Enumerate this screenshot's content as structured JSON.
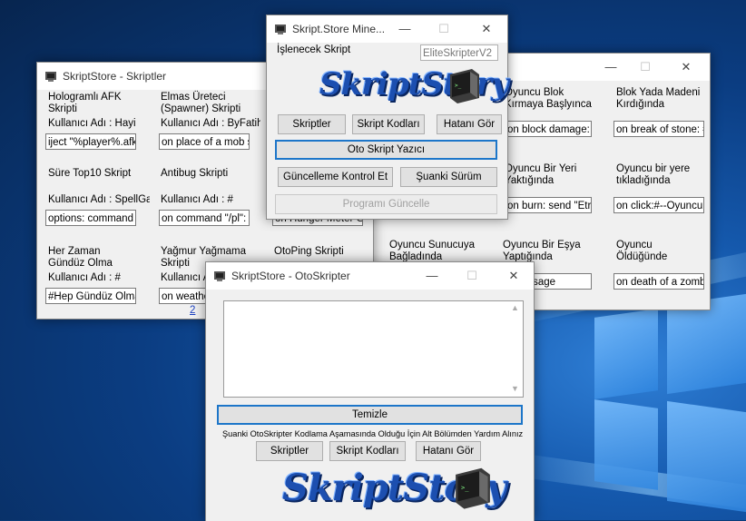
{
  "desktop": {
    "bg": "#0b3c78"
  },
  "win_scripts": {
    "title": "SkriptStore - Skriptler",
    "page_link": "2",
    "cards": [
      {
        "name": "Hologramlı AFK Skripti",
        "user": "Kullanıcı Adı : Hayi",
        "code": "iject \"%player%.afk\""
      },
      {
        "name": "Elmas Üreteci (Spawner) Skripti",
        "user": "Kullanıcı Adı : ByFatih",
        "code": "on place of a mob sp"
      },
      {
        "name": "Süre Top10 Skript",
        "user": "Kullanıcı Adı : SpellGame",
        "code": "options:   command"
      },
      {
        "name": "Antibug Skripti",
        "user": "Kullanıcı Adı : #",
        "code": "on command \"/pl\":"
      },
      {
        "name": "Her Zaman Gündüz Olma",
        "user": "Kullanıcı Adı : #",
        "code": "#Hep Gündüz Olma"
      },
      {
        "name": "Yağmur Yağmama Skripti",
        "user": "Kullanıcı A",
        "code": "on weathe"
      },
      {
        "name": "OtoPing Skripti",
        "user": "",
        "code": ""
      }
    ],
    "hidden_code": "on Hunger Meter Gr"
  },
  "win_events": {
    "cards": [
      {
        "name": "Oyuncu Blok Kırmaya Başlyınca",
        "code": "on block damage:"
      },
      {
        "name": "Blok Yada Madeni Kırdığında",
        "code": "on break of stone: #"
      },
      {
        "name": "Oyuncu Bir Yeri Yaktığında",
        "code": "on burn:   send \"Etr"
      },
      {
        "name": "Oyuncu bir yere tıkladığında",
        "code": "on click:#--Oyuncu"
      },
      {
        "name": "Oyuncu Sunucuya Bağladında",
        "code": ""
      },
      {
        "name": "Oyuncu Bir Eşya Yaptığında",
        "code": ":   message"
      },
      {
        "name": "Oyuncu Öldüğünde",
        "code": "on death of a zombi"
      }
    ]
  },
  "win_main": {
    "title": "Skript.Store Mine...",
    "script_label": "İşlenecek Skript",
    "script_value": "EliteSkripterV2",
    "logo_text": "SkriptStory",
    "btn_scripts": "Skriptler",
    "btn_codes": "Skript Kodları",
    "btn_report": "Hatanı Gör",
    "btn_auto": "Oto Skript Yazıcı",
    "btn_update_check": "Güncelleme Kontrol Et",
    "btn_version": "Şuanki Sürüm",
    "btn_update": "Programı Güncelle"
  },
  "win_auto": {
    "title": "SkriptStore - OtoSkripter",
    "textarea_value": "",
    "btn_clear": "Temizle",
    "notice": "Şuanki OtoSkripter Kodlama Aşamasında Olduğu İçin Alt Bölümden Yardım Alınız",
    "btn_scripts": "Skriptler",
    "btn_codes": "Skript Kodları",
    "btn_report": "Hatanı Gör",
    "logo_text": "SkriptStory"
  },
  "icons": {
    "minimize": "minimize-icon",
    "maximize": "maximize-icon",
    "close": "close-icon",
    "app": "computer-icon"
  }
}
